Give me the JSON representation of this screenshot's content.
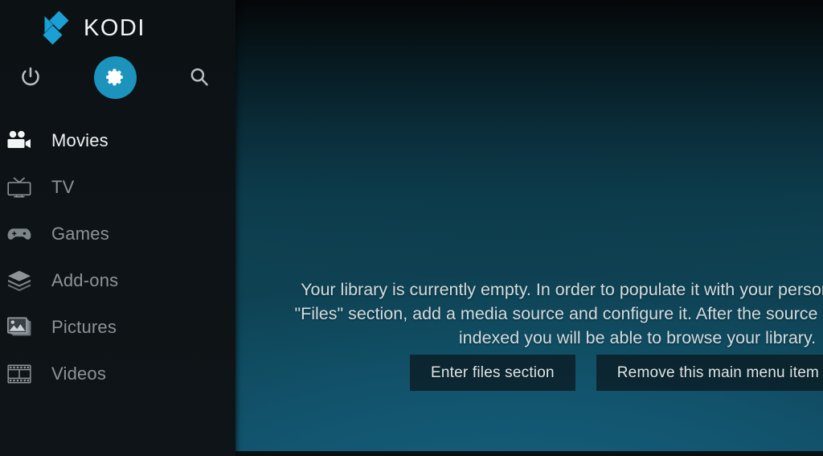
{
  "app": {
    "name": "KODI",
    "logo_color": "#1aa0d4"
  },
  "sidebar": {
    "top_icons": [
      {
        "name": "power-icon",
        "label": "Power"
      },
      {
        "name": "settings-icon",
        "label": "Settings",
        "selected": true,
        "highlight_color": "#1b93bd"
      },
      {
        "name": "search-icon",
        "label": "Search"
      }
    ],
    "items": [
      {
        "label": "Movies",
        "icon": "movie-camera-icon",
        "selected": true
      },
      {
        "label": "TV",
        "icon": "television-icon",
        "selected": false
      },
      {
        "label": "Games",
        "icon": "gamepad-icon",
        "selected": false
      },
      {
        "label": "Add-ons",
        "icon": "open-box-icon",
        "selected": false
      },
      {
        "label": "Pictures",
        "icon": "photo-icon",
        "selected": false
      },
      {
        "label": "Videos",
        "icon": "film-strip-icon",
        "selected": false
      }
    ]
  },
  "main": {
    "empty_message": "Your library is currently empty. In order to populate it with your personal media, enter the\n\"Files\" section, add a media source and configure it. After the source has been added and\nindexed you will be able to browse your library.",
    "buttons": [
      {
        "label": "Enter files section"
      },
      {
        "label": "Remove this main menu item"
      }
    ]
  }
}
